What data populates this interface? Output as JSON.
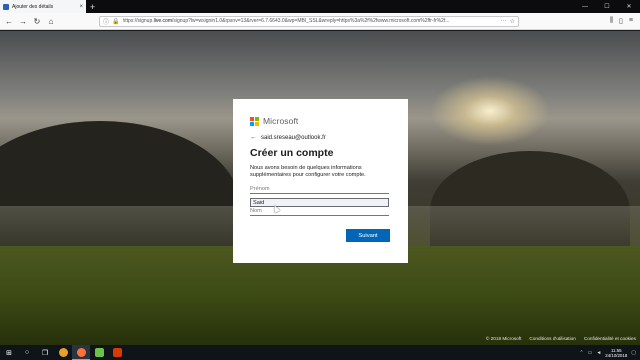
{
  "browser": {
    "tab_title": "Ajouter des détails",
    "tab_close": "×",
    "new_tab": "+",
    "window_controls": [
      "—",
      "☐",
      "✕"
    ],
    "url_prefix": "https://signup.",
    "url_host": "live.com",
    "url_rest": "/signup?lw=wsignin1.0&rpsnv=13&rver=6.7.6643.0&wp=MBI_SSL&wreply=https%3a%2f%2fwww.microsoft.com%2ffr-fr%2f...",
    "url_more": "···",
    "back_icon": "←",
    "forward_icon": "→",
    "reload_icon": "↻",
    "home_icon": "⌂"
  },
  "card": {
    "brand": "Microsoft",
    "brand_colors": [
      "#f25022",
      "#7fba00",
      "#00a4ef",
      "#ffb900"
    ],
    "back_arrow": "←",
    "email": "said.sreseau@outlook.fr",
    "title": "Créer un compte",
    "description": "Nous avons besoin de quelques informations supplémentaires pour configurer votre compte.",
    "first_name_placeholder": "Prénom",
    "first_name_value": "Said",
    "last_name_placeholder": "Nom",
    "next_button": "Suivant"
  },
  "footer": {
    "copyright": "© 2018 Microsoft",
    "terms": "Conditions d'utilisation",
    "privacy": "Confidentialité et cookies"
  },
  "taskbar": {
    "start_icon": "⊞",
    "search_icon": "○",
    "taskview_icon": "❐",
    "apps": [
      {
        "name": "chrome",
        "color": "#e8a02a"
      },
      {
        "name": "firefox",
        "color": "#ff7139"
      },
      {
        "name": "app-green",
        "color": "#6cc24a"
      },
      {
        "name": "app-red",
        "color": "#d83b01"
      }
    ],
    "time": "11:55",
    "date": "24/10/2018"
  }
}
